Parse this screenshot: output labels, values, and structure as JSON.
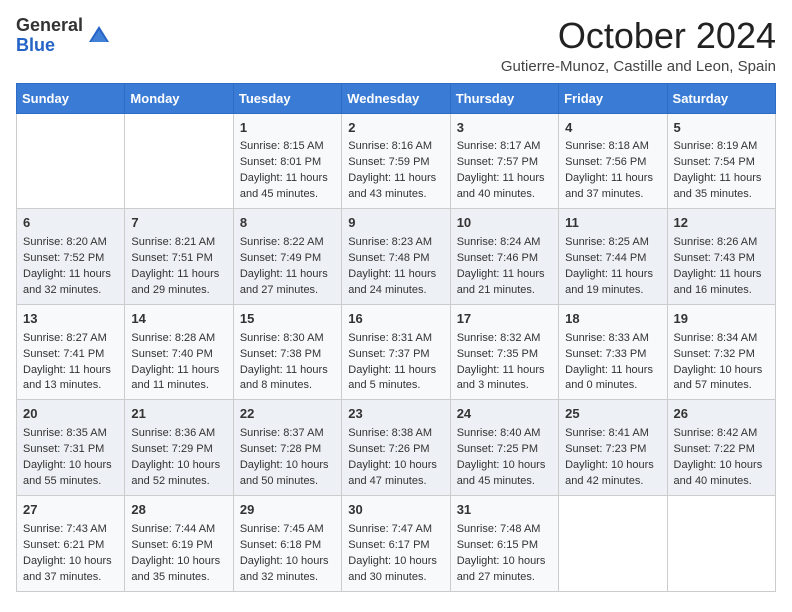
{
  "header": {
    "logo_general": "General",
    "logo_blue": "Blue",
    "month_year": "October 2024",
    "location": "Gutierre-Munoz, Castille and Leon, Spain"
  },
  "days_of_week": [
    "Sunday",
    "Monday",
    "Tuesday",
    "Wednesday",
    "Thursday",
    "Friday",
    "Saturday"
  ],
  "weeks": [
    [
      {
        "day": "",
        "content": ""
      },
      {
        "day": "",
        "content": ""
      },
      {
        "day": "1",
        "content": "Sunrise: 8:15 AM\nSunset: 8:01 PM\nDaylight: 11 hours and 45 minutes."
      },
      {
        "day": "2",
        "content": "Sunrise: 8:16 AM\nSunset: 7:59 PM\nDaylight: 11 hours and 43 minutes."
      },
      {
        "day": "3",
        "content": "Sunrise: 8:17 AM\nSunset: 7:57 PM\nDaylight: 11 hours and 40 minutes."
      },
      {
        "day": "4",
        "content": "Sunrise: 8:18 AM\nSunset: 7:56 PM\nDaylight: 11 hours and 37 minutes."
      },
      {
        "day": "5",
        "content": "Sunrise: 8:19 AM\nSunset: 7:54 PM\nDaylight: 11 hours and 35 minutes."
      }
    ],
    [
      {
        "day": "6",
        "content": "Sunrise: 8:20 AM\nSunset: 7:52 PM\nDaylight: 11 hours and 32 minutes."
      },
      {
        "day": "7",
        "content": "Sunrise: 8:21 AM\nSunset: 7:51 PM\nDaylight: 11 hours and 29 minutes."
      },
      {
        "day": "8",
        "content": "Sunrise: 8:22 AM\nSunset: 7:49 PM\nDaylight: 11 hours and 27 minutes."
      },
      {
        "day": "9",
        "content": "Sunrise: 8:23 AM\nSunset: 7:48 PM\nDaylight: 11 hours and 24 minutes."
      },
      {
        "day": "10",
        "content": "Sunrise: 8:24 AM\nSunset: 7:46 PM\nDaylight: 11 hours and 21 minutes."
      },
      {
        "day": "11",
        "content": "Sunrise: 8:25 AM\nSunset: 7:44 PM\nDaylight: 11 hours and 19 minutes."
      },
      {
        "day": "12",
        "content": "Sunrise: 8:26 AM\nSunset: 7:43 PM\nDaylight: 11 hours and 16 minutes."
      }
    ],
    [
      {
        "day": "13",
        "content": "Sunrise: 8:27 AM\nSunset: 7:41 PM\nDaylight: 11 hours and 13 minutes."
      },
      {
        "day": "14",
        "content": "Sunrise: 8:28 AM\nSunset: 7:40 PM\nDaylight: 11 hours and 11 minutes."
      },
      {
        "day": "15",
        "content": "Sunrise: 8:30 AM\nSunset: 7:38 PM\nDaylight: 11 hours and 8 minutes."
      },
      {
        "day": "16",
        "content": "Sunrise: 8:31 AM\nSunset: 7:37 PM\nDaylight: 11 hours and 5 minutes."
      },
      {
        "day": "17",
        "content": "Sunrise: 8:32 AM\nSunset: 7:35 PM\nDaylight: 11 hours and 3 minutes."
      },
      {
        "day": "18",
        "content": "Sunrise: 8:33 AM\nSunset: 7:33 PM\nDaylight: 11 hours and 0 minutes."
      },
      {
        "day": "19",
        "content": "Sunrise: 8:34 AM\nSunset: 7:32 PM\nDaylight: 10 hours and 57 minutes."
      }
    ],
    [
      {
        "day": "20",
        "content": "Sunrise: 8:35 AM\nSunset: 7:31 PM\nDaylight: 10 hours and 55 minutes."
      },
      {
        "day": "21",
        "content": "Sunrise: 8:36 AM\nSunset: 7:29 PM\nDaylight: 10 hours and 52 minutes."
      },
      {
        "day": "22",
        "content": "Sunrise: 8:37 AM\nSunset: 7:28 PM\nDaylight: 10 hours and 50 minutes."
      },
      {
        "day": "23",
        "content": "Sunrise: 8:38 AM\nSunset: 7:26 PM\nDaylight: 10 hours and 47 minutes."
      },
      {
        "day": "24",
        "content": "Sunrise: 8:40 AM\nSunset: 7:25 PM\nDaylight: 10 hours and 45 minutes."
      },
      {
        "day": "25",
        "content": "Sunrise: 8:41 AM\nSunset: 7:23 PM\nDaylight: 10 hours and 42 minutes."
      },
      {
        "day": "26",
        "content": "Sunrise: 8:42 AM\nSunset: 7:22 PM\nDaylight: 10 hours and 40 minutes."
      }
    ],
    [
      {
        "day": "27",
        "content": "Sunrise: 7:43 AM\nSunset: 6:21 PM\nDaylight: 10 hours and 37 minutes."
      },
      {
        "day": "28",
        "content": "Sunrise: 7:44 AM\nSunset: 6:19 PM\nDaylight: 10 hours and 35 minutes."
      },
      {
        "day": "29",
        "content": "Sunrise: 7:45 AM\nSunset: 6:18 PM\nDaylight: 10 hours and 32 minutes."
      },
      {
        "day": "30",
        "content": "Sunrise: 7:47 AM\nSunset: 6:17 PM\nDaylight: 10 hours and 30 minutes."
      },
      {
        "day": "31",
        "content": "Sunrise: 7:48 AM\nSunset: 6:15 PM\nDaylight: 10 hours and 27 minutes."
      },
      {
        "day": "",
        "content": ""
      },
      {
        "day": "",
        "content": ""
      }
    ]
  ]
}
